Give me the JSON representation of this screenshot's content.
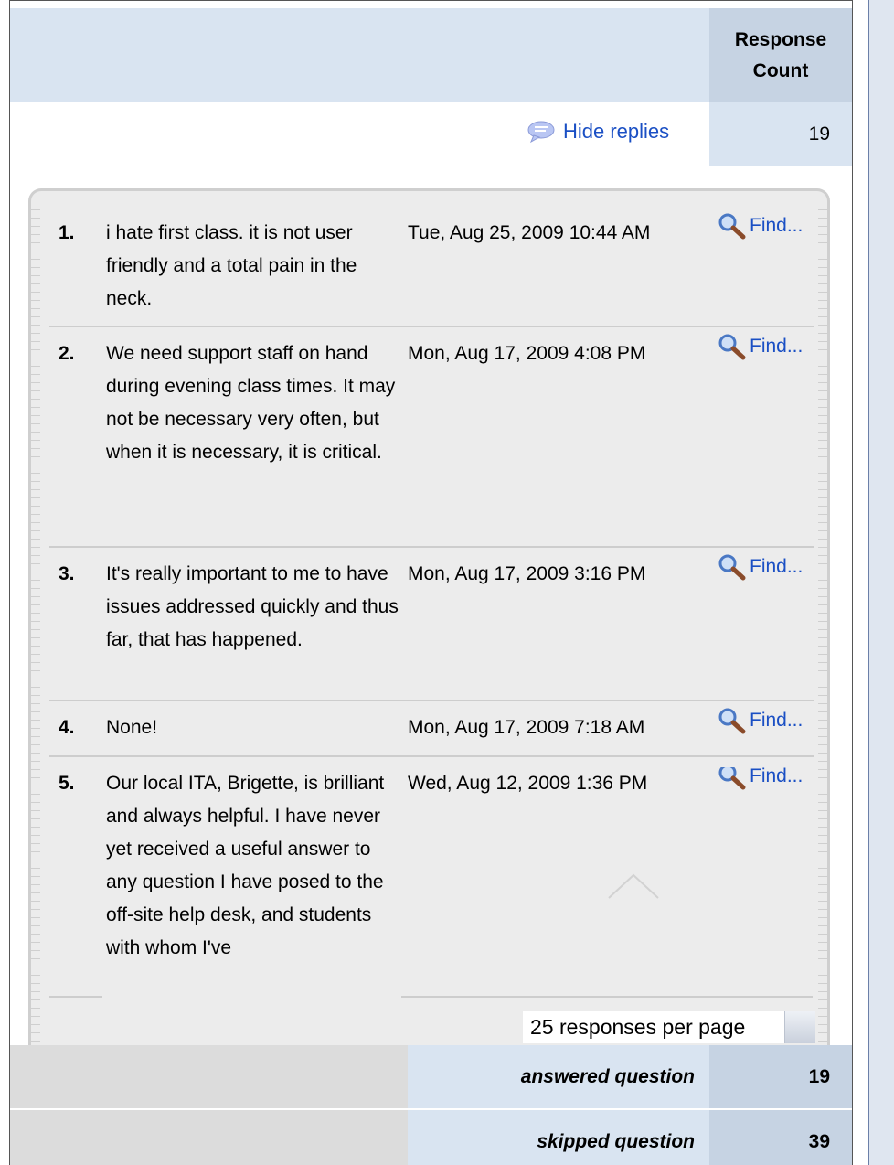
{
  "header": {
    "count_label": "Response Count"
  },
  "replies_toggle": {
    "label": "Hide replies",
    "count": "19"
  },
  "replies": [
    {
      "num": "1.",
      "text": "i hate first class. it is not user friendly and a total pain in the neck.",
      "date": "Tue, Aug 25, 2009 10:44 AM",
      "find": "Find..."
    },
    {
      "num": "2.",
      "text": "We need support staff on hand during evening class times. It may not be necessary very often, but when it is necessary, it is critical.",
      "date": "Mon, Aug 17, 2009 4:08 PM",
      "find": "Find..."
    },
    {
      "num": "3.",
      "text": "It's really important to me to have issues addressed quickly and thus far, that has happened.",
      "date": "Mon, Aug 17, 2009 3:16 PM",
      "find": "Find..."
    },
    {
      "num": "4.",
      "text": "None!",
      "date": "Mon, Aug 17, 2009 7:18 AM",
      "find": "Find..."
    },
    {
      "num": "5.",
      "text": "Our local ITA, Brigette, is brilliant and always helpful. I have never yet received a useful answer to any question I have posed to the off-site help desk, and students with whom I've",
      "date": "Wed, Aug 12, 2009 1:36 PM",
      "find": "Find..."
    }
  ],
  "pagination": {
    "per_page_label": "25 responses per page"
  },
  "summary": {
    "answered_label": "answered question",
    "answered_value": "19",
    "skipped_label": "skipped question",
    "skipped_value": "39"
  },
  "colors": {
    "link": "#1a4fc4",
    "header_band": "#d9e4f1",
    "header_count": "#c6d3e3",
    "replies_bg": "#ececec"
  },
  "icons": [
    "speech-bubble-icon",
    "magnifier-icon",
    "chevron-up-icon",
    "dropdown-arrow-icon"
  ]
}
